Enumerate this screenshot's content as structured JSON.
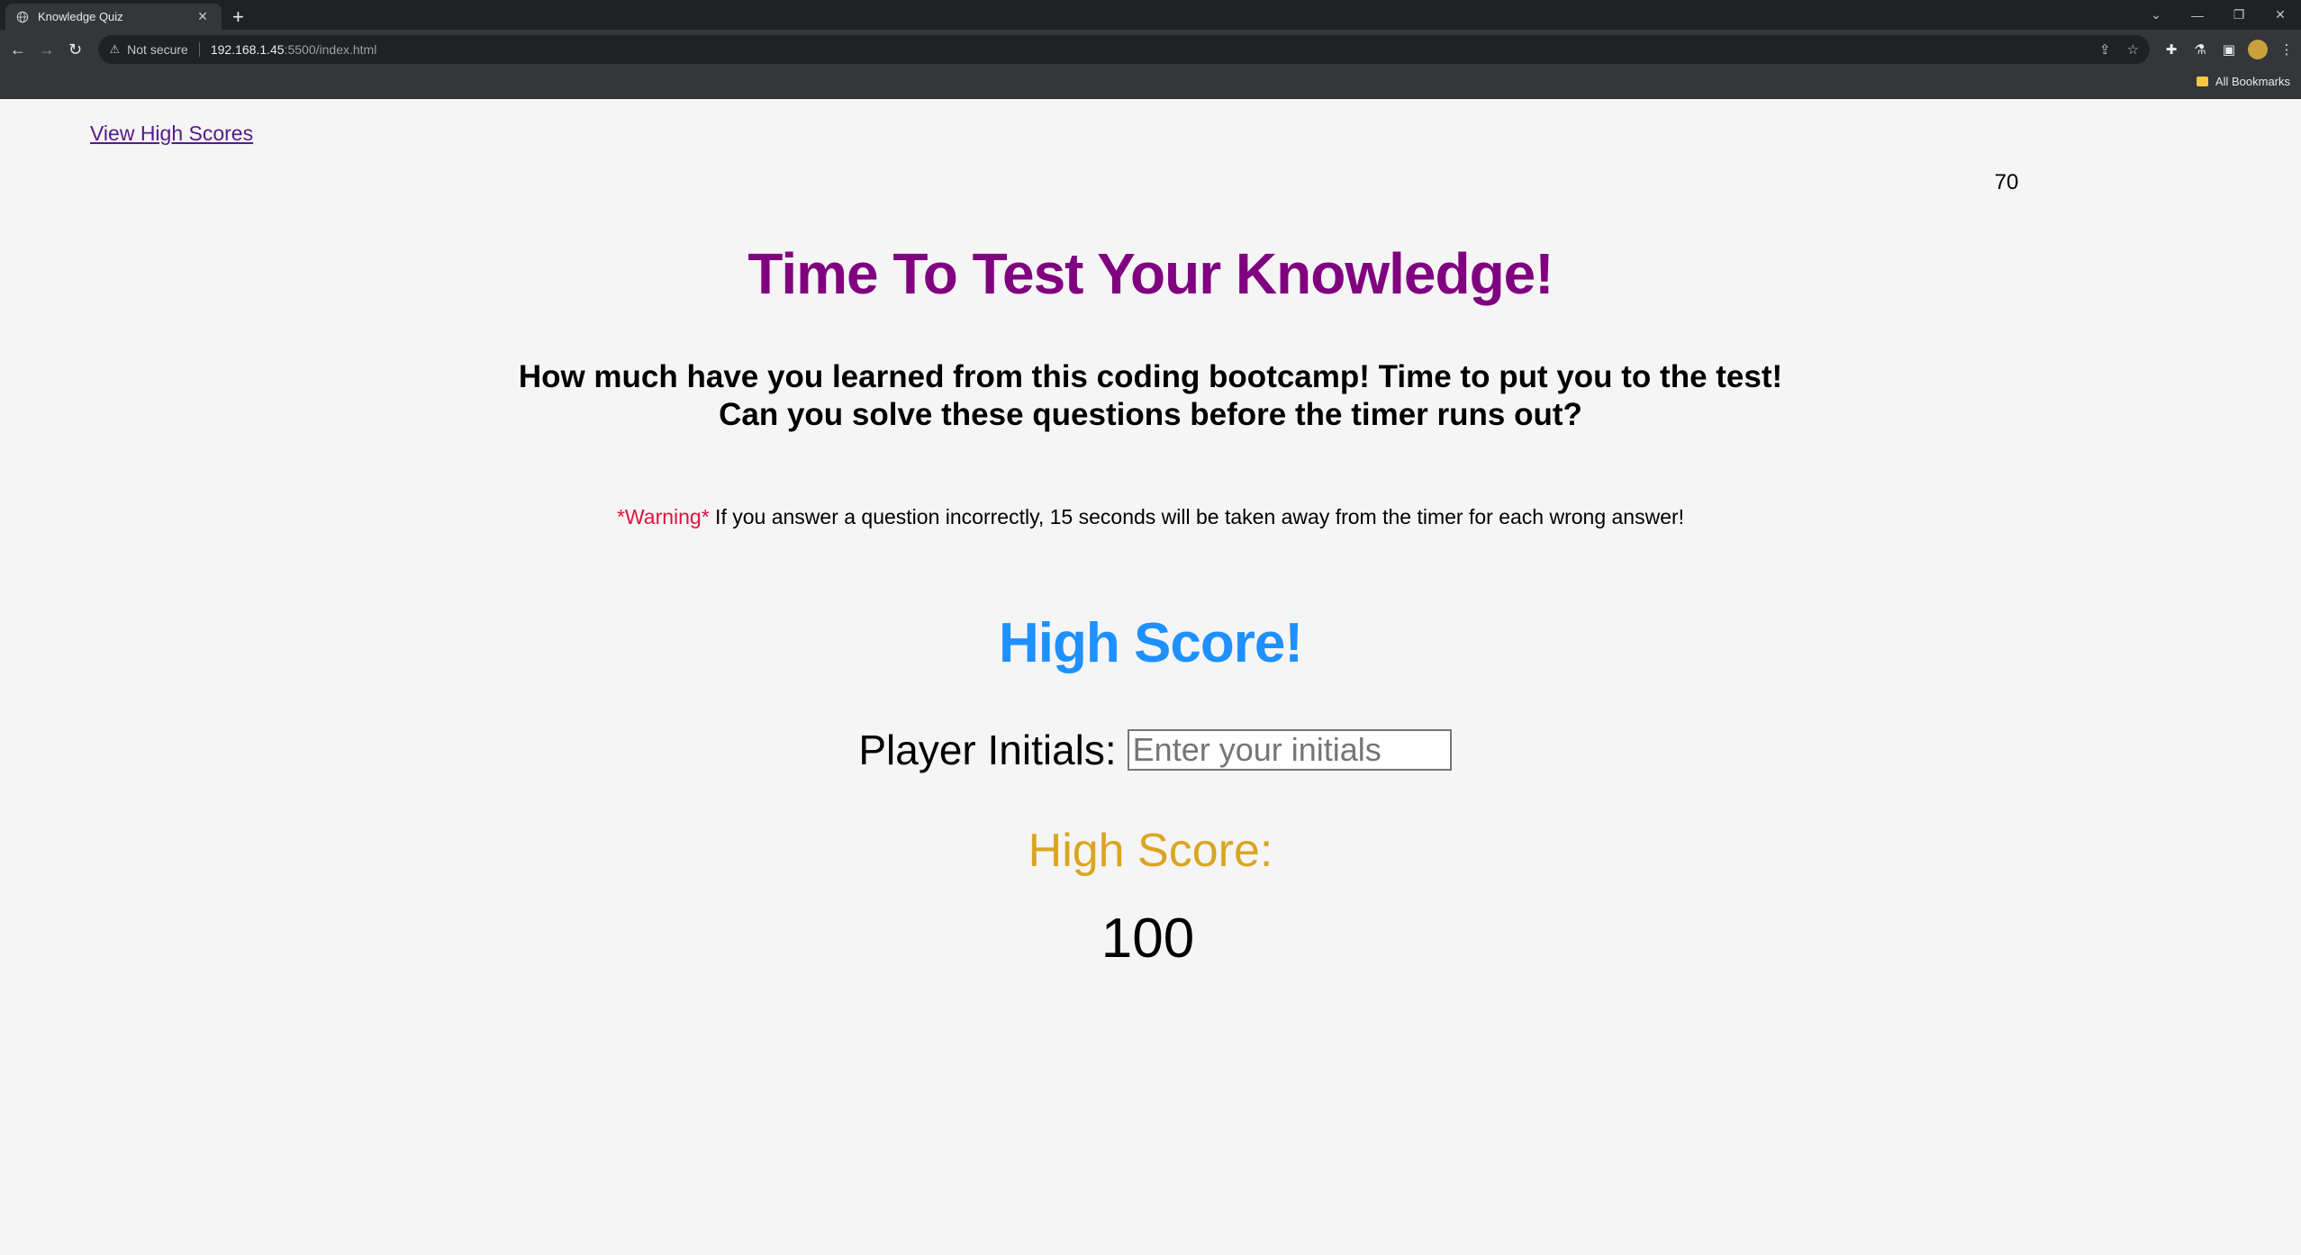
{
  "browser": {
    "tab_title": "Knowledge Quiz",
    "tab_close": "✕",
    "new_tab": "+",
    "security_label": "Not secure",
    "url_host": "192.168.1.45",
    "url_path": ":5500/index.html",
    "bookmarks_label": "All Bookmarks",
    "window_controls": {
      "minimize": "—",
      "restore": "❐",
      "close": "✕"
    }
  },
  "page": {
    "view_high_scores": "View High Scores",
    "timer": "70",
    "title": "Time To Test Your Knowledge!",
    "intro_line1": "How much have you learned from this coding bootcamp! Time to put you to the test!",
    "intro_line2": "Can you solve these questions before the timer runs out?",
    "warning_tag": "*Warning*",
    "warning_text": " If you answer a question incorrectly, 15 seconds will be taken away from the timer for each wrong answer!",
    "high_score_heading": "High Score!",
    "initials_label": "Player Initials:",
    "initials_placeholder": "Enter your initials",
    "initials_value": "",
    "score_label": "High Score:",
    "score_value": "100"
  },
  "colors": {
    "title": "#800080",
    "warning_tag": "#dc143c",
    "high_score_heading": "#1e90ff",
    "score_label": "#daa520",
    "link": "#551a8b"
  }
}
